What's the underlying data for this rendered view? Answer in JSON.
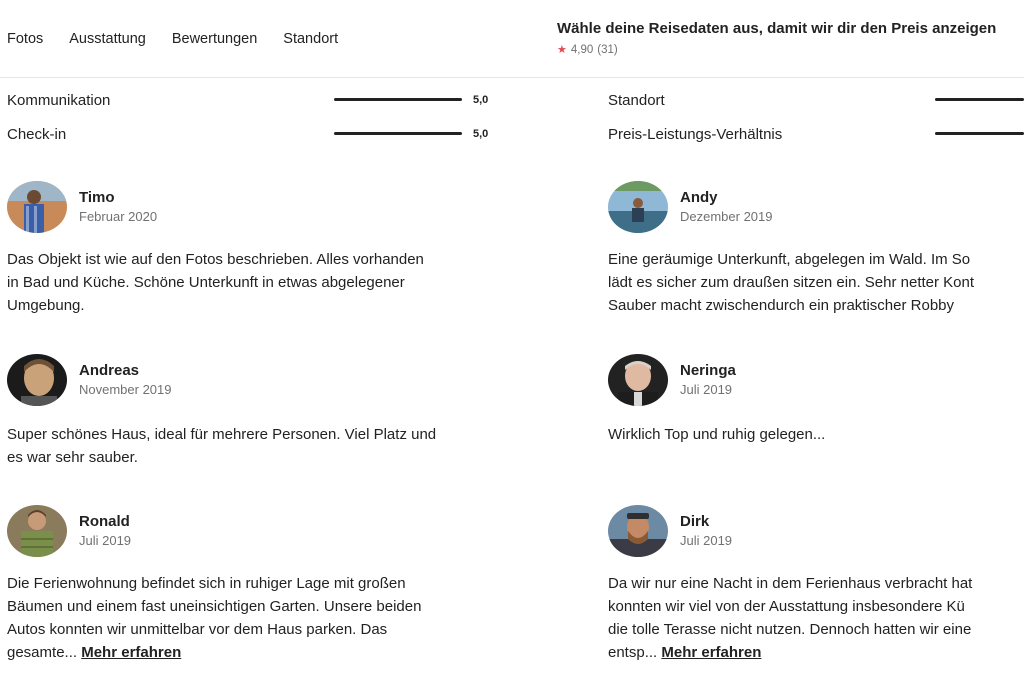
{
  "header": {
    "nav": [
      "Fotos",
      "Ausstattung",
      "Bewertungen",
      "Standort"
    ],
    "cta_title": "Wähle deine Reisedaten aus, damit wir dir den Preis anzeigen",
    "rating_value": "4,90",
    "rating_count": "(31)",
    "star_icon": "star-icon",
    "star_color": "#e5484d"
  },
  "categories": {
    "left": [
      {
        "label": "Kommunikation",
        "score": "5,0",
        "fraction": 1.0
      },
      {
        "label": "Check-in",
        "score": "5,0",
        "fraction": 1.0
      }
    ],
    "right": [
      {
        "label": "Standort",
        "fraction": 1.0
      },
      {
        "label": "Preis-Leistungs-Verhältnis",
        "fraction": 1.0
      }
    ]
  },
  "reviews": {
    "left": [
      {
        "name": "Timo",
        "date": "Februar 2020",
        "text": [
          "Das Objekt ist wie auf den Fotos beschrieben. Alles vorhanden",
          "in Bad und Küche. Schöne Unterkunft in etwas abgelegener",
          "Umgebung."
        ]
      },
      {
        "name": "Andreas",
        "date": "November 2019",
        "text": [
          "Super schönes Haus, ideal für mehrere Personen. Viel Platz und",
          "es war sehr sauber."
        ]
      },
      {
        "name": "Ronald",
        "date": "Juli 2019",
        "text": [
          "Die Ferienwohnung befindet sich in ruhiger Lage mit großen",
          "Bäumen und einem fast uneinsichtigen Garten. Unsere beiden",
          "Autos konnten wir unmittelbar vor dem Haus parken. Das",
          "gesamte..."
        ],
        "more": "Mehr erfahren"
      }
    ],
    "right": [
      {
        "name": "Andy",
        "date": "Dezember 2019",
        "text": [
          "Eine geräumige Unterkunft, abgelegen im Wald. Im So",
          "lädt es sicher zum draußen sitzen ein. Sehr netter Kont",
          "Sauber macht zwischendurch ein praktischer Robby"
        ]
      },
      {
        "name": "Neringa",
        "date": "Juli 2019",
        "text": [
          "Wirklich Top und ruhig gelegen..."
        ]
      },
      {
        "name": "Dirk",
        "date": "Juli 2019",
        "text": [
          "Da wir nur eine Nacht in dem Ferienhaus verbracht hat",
          "konnten wir viel von der Ausstattung insbesondere Kü",
          "die tolle Terasse nicht nutzen. Dennoch hatten wir eine",
          "entsp..."
        ],
        "more": "Mehr erfahren"
      }
    ]
  }
}
